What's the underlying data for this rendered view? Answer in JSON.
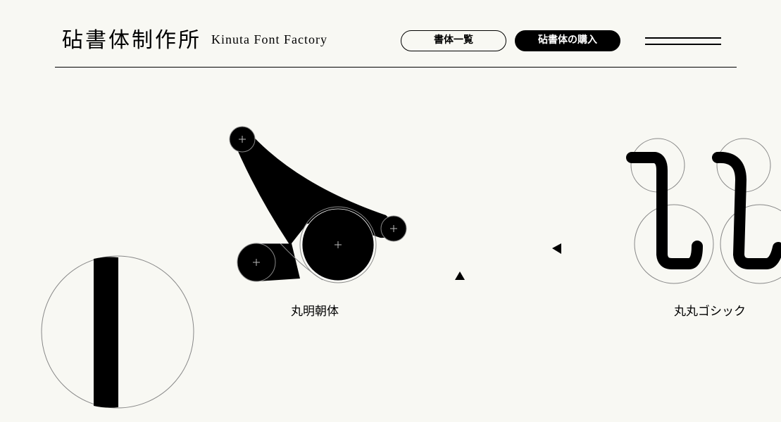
{
  "header": {
    "logo_jp": "砧書体制作所",
    "logo_en": "Kinuta Font Factory",
    "nav": {
      "typeface_list_label": "書体一覧",
      "purchase_label": "砧書体の購入"
    },
    "menu_icon": "hamburger-menu-icon"
  },
  "showcase": {
    "items": [
      {
        "label": "丸明朝体",
        "glyph_icon": "mincho-stroke-construction"
      },
      {
        "label": "丸丸ゴシック",
        "glyph_icon": "gothic-stroke-construction"
      }
    ],
    "decorative": [
      "vertical-stroke-circle",
      "triangle-up-icon",
      "triangle-left-icon"
    ]
  },
  "colors": {
    "background": "#f8f8f3",
    "ink": "#000000"
  }
}
